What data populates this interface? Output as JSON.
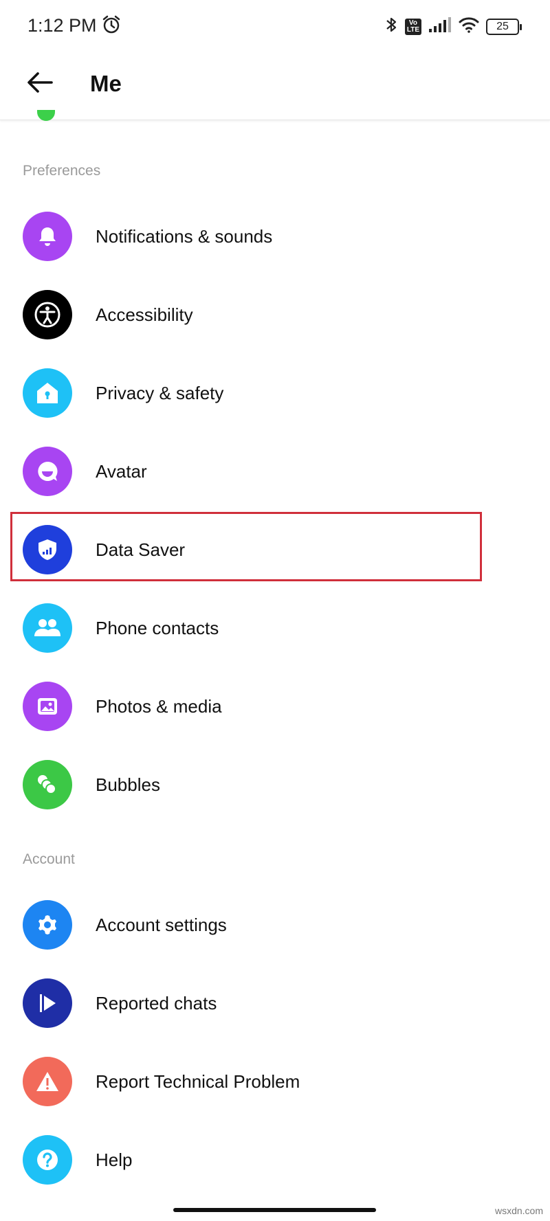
{
  "status_bar": {
    "time": "1:12 PM",
    "battery": "25",
    "volte_top": "Vo",
    "volte_bottom": "LTE"
  },
  "header": {
    "title": "Me"
  },
  "sections": {
    "preferences": "Preferences",
    "account": "Account"
  },
  "preferences_items": [
    {
      "label": "Notifications & sounds",
      "icon": "bell-icon",
      "color": "#a845f2"
    },
    {
      "label": "Accessibility",
      "icon": "accessibility-icon",
      "color": "#000000"
    },
    {
      "label": "Privacy & safety",
      "icon": "home-lock-icon",
      "color": "#1ec1f6"
    },
    {
      "label": "Avatar",
      "icon": "avatar-face-icon",
      "color": "#a845f2"
    },
    {
      "label": "Data Saver",
      "icon": "shield-signal-icon",
      "color": "#1f3fdc"
    },
    {
      "label": "Phone contacts",
      "icon": "contacts-icon",
      "color": "#1ec1f6"
    },
    {
      "label": "Photos & media",
      "icon": "photo-icon",
      "color": "#a845f2"
    },
    {
      "label": "Bubbles",
      "icon": "bubbles-icon",
      "color": "#3cc846"
    }
  ],
  "account_items": [
    {
      "label": "Account settings",
      "icon": "gear-icon",
      "color": "#1d85f2"
    },
    {
      "label": "Reported chats",
      "icon": "flag-icon",
      "color": "#1f2ea6"
    },
    {
      "label": "Report Technical Problem",
      "icon": "warning-icon",
      "color": "#f26a5a"
    },
    {
      "label": "Help",
      "icon": "help-icon",
      "color": "#1ec1f6"
    }
  ],
  "highlight_color": "#d02f3b",
  "watermark": "wsxdn.com"
}
